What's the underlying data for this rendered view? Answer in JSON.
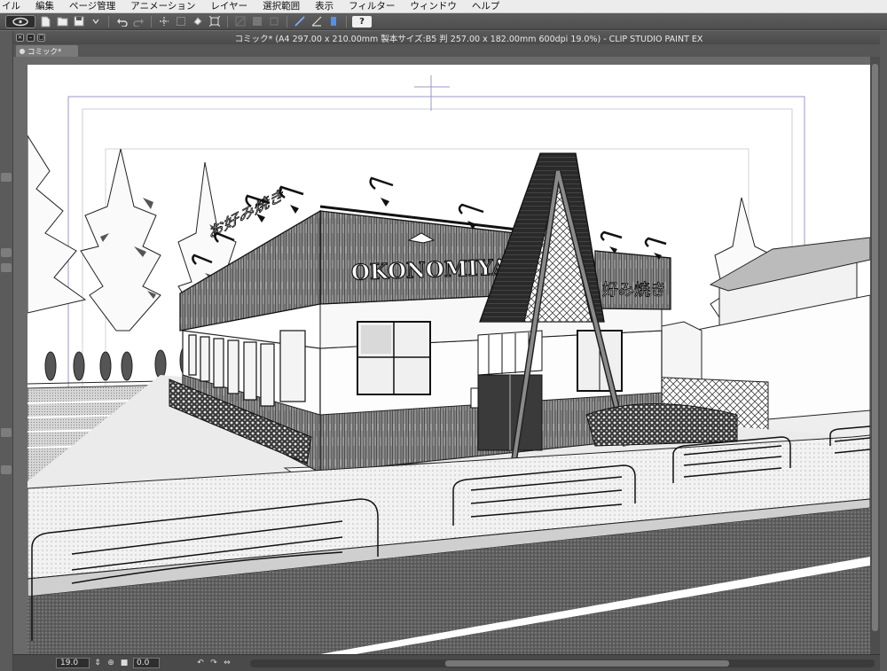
{
  "menu": [
    "イル",
    "編集",
    "ページ管理",
    "アニメーション",
    "レイヤー",
    "選択範囲",
    "表示",
    "フィルター",
    "ウィンドウ",
    "ヘルプ"
  ],
  "toolbar": {
    "help_label": "?",
    "icons": [
      "app-logo-icon",
      "new-file-icon",
      "open-file-icon",
      "save-icon",
      "save-as-icon",
      "undo-icon",
      "redo-icon",
      "transform-icon",
      "select-all-icon",
      "fill-icon",
      "zoom-fit-icon",
      "snap-ruler-icon",
      "snap-grid-icon",
      "snap-special-icon"
    ]
  },
  "window": {
    "title": "コミック* (A4 297.00 x 210.00mm 製本サイズ:B5 判 257.00 x 182.00mm 600dpi 19.0%)  - CLIP STUDIO PAINT EX",
    "tab_label": "コミック*"
  },
  "artwork": {
    "sign_text": "OKONOMIYAKI",
    "side_sign_text": "お好み焼き",
    "side_sign_text_2": "好み焼き"
  },
  "status": {
    "zoom": "19.0",
    "rotation": "0.0"
  },
  "colors": {
    "workspace": "#6a6a6a",
    "panel": "#4a4a4a",
    "paper": "#ffffff",
    "guide": "#9a9ac8"
  }
}
